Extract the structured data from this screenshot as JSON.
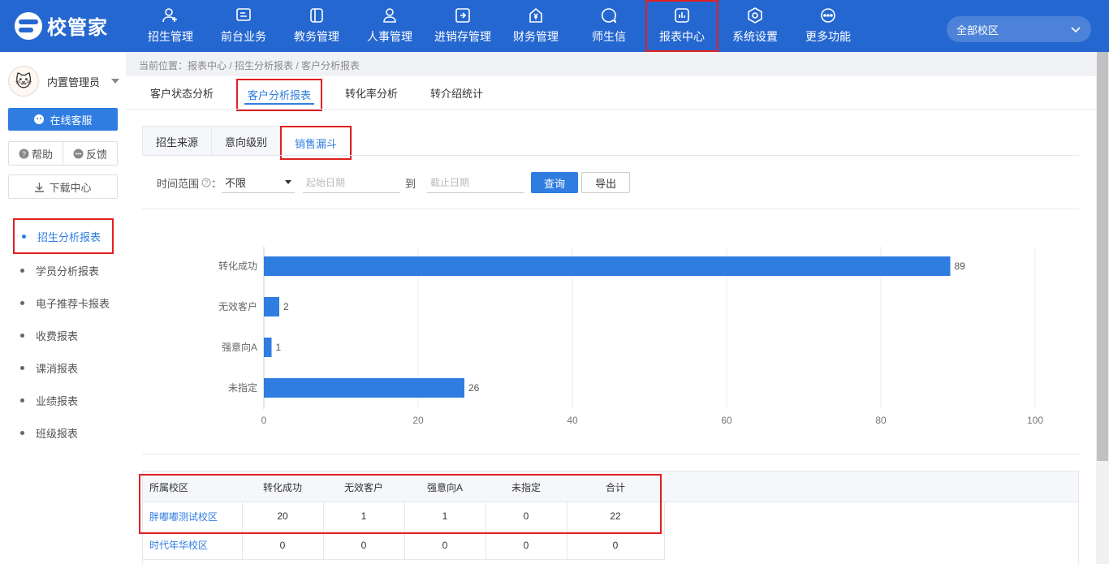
{
  "app": {
    "logo_text": "校管家"
  },
  "nav": [
    {
      "label": "招生管理",
      "icon": "user-plus-icon"
    },
    {
      "label": "前台业务",
      "icon": "monitor-icon"
    },
    {
      "label": "教务管理",
      "icon": "book-icon"
    },
    {
      "label": "人事管理",
      "icon": "person-icon"
    },
    {
      "label": "进销存管理",
      "icon": "inventory-icon"
    },
    {
      "label": "财务管理",
      "icon": "yen-icon"
    },
    {
      "label": "师生信",
      "icon": "chat-icon"
    },
    {
      "label": "报表中心",
      "icon": "report-icon",
      "active": true
    },
    {
      "label": "系统设置",
      "icon": "settings-icon"
    },
    {
      "label": "更多功能",
      "icon": "more-icon"
    }
  ],
  "campus_select": {
    "value": "全部校区"
  },
  "user": {
    "name": "内置管理员"
  },
  "sidebar": {
    "service_label": "在线客服",
    "help_label": "帮助",
    "feedback_label": "反馈",
    "download_label": "下载中心",
    "menu": [
      {
        "label": "招生分析报表",
        "active": true
      },
      {
        "label": "学员分析报表"
      },
      {
        "label": "电子推荐卡报表"
      },
      {
        "label": "收费报表"
      },
      {
        "label": "课消报表"
      },
      {
        "label": "业绩报表"
      },
      {
        "label": "班级报表"
      }
    ]
  },
  "breadcrumb": "当前位置：报表中心 / 招生分析报表 / 客户分析报表",
  "tabs": [
    {
      "label": "客户状态分析"
    },
    {
      "label": "客户分析报表",
      "active": true
    },
    {
      "label": "转化率分析"
    },
    {
      "label": "转介绍统计"
    }
  ],
  "subtabs": [
    {
      "label": "招生来源"
    },
    {
      "label": "意向级别"
    },
    {
      "label": "销售漏斗",
      "active": true
    }
  ],
  "filter": {
    "time_label": "时间范围",
    "time_value": "不限",
    "start_placeholder": "起始日期",
    "to_label": "到",
    "end_placeholder": "截止日期",
    "query_label": "查询",
    "export_label": "导出"
  },
  "chart_data": {
    "type": "bar",
    "orientation": "horizontal",
    "categories": [
      "转化成功",
      "无效客户",
      "强意向A",
      "未指定"
    ],
    "values": [
      89,
      2,
      1,
      26
    ],
    "xlim": [
      0,
      100
    ],
    "xticks": [
      0,
      20,
      40,
      60,
      80,
      100
    ],
    "bar_color": "#2f7de1",
    "grid": true
  },
  "table": {
    "columns": [
      "所属校区",
      "转化成功",
      "无效客户",
      "强意向A",
      "未指定",
      "合计"
    ],
    "rows": [
      [
        "胖嘟嘟测试校区",
        "20",
        "1",
        "1",
        "0",
        "22"
      ],
      [
        "时代年华校区",
        "0",
        "0",
        "0",
        "0",
        "0"
      ]
    ]
  }
}
